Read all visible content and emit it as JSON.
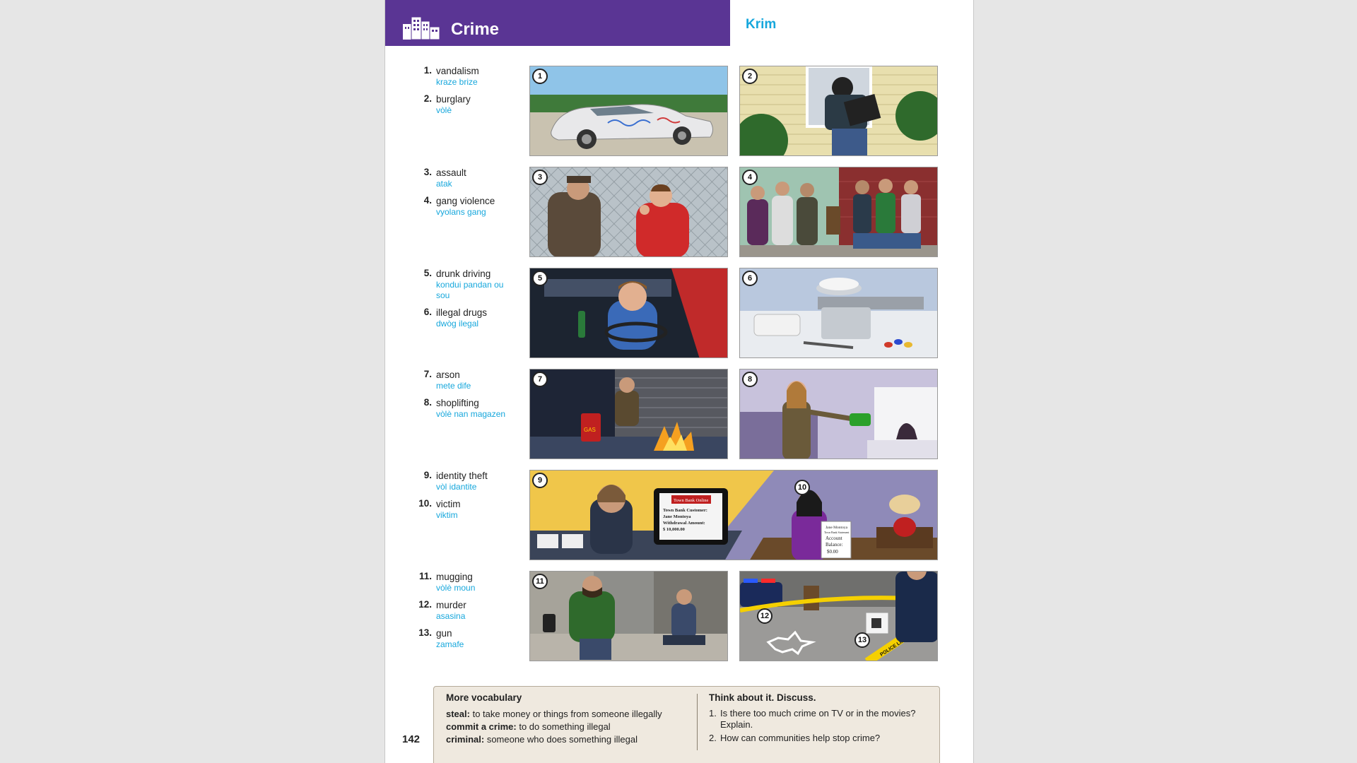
{
  "header": {
    "title": "Crime",
    "translation": "Krim"
  },
  "vocab": [
    {
      "num": "1.",
      "en": "vandalism",
      "ht": "kraze brize"
    },
    {
      "num": "2.",
      "en": "burglary",
      "ht": "vòlè"
    },
    {
      "num": "3.",
      "en": "assault",
      "ht": "atak"
    },
    {
      "num": "4.",
      "en": "gang violence",
      "ht": "vyolans gang"
    },
    {
      "num": "5.",
      "en": "drunk driving",
      "ht": "kondui pandan ou sou"
    },
    {
      "num": "6.",
      "en": "illegal drugs",
      "ht": "dwòg ilegal"
    },
    {
      "num": "7.",
      "en": "arson",
      "ht": "mete dife"
    },
    {
      "num": "8.",
      "en": "shoplifting",
      "ht": "vòlè nan magazen"
    },
    {
      "num": "9.",
      "en": "identity theft",
      "ht": "vòl idantite"
    },
    {
      "num": "10.",
      "en": "victim",
      "ht": "viktim"
    },
    {
      "num": "11.",
      "en": "mugging",
      "ht": "vòlè moun"
    },
    {
      "num": "12.",
      "en": "murder",
      "ht": "asasina"
    },
    {
      "num": "13.",
      "en": "gun",
      "ht": "zamafe"
    }
  ],
  "badges": [
    "1",
    "2",
    "3",
    "4",
    "5",
    "6",
    "7",
    "8",
    "9",
    "10",
    "11",
    "12",
    "13"
  ],
  "illustration_text": {
    "gas_can": "GAS",
    "bank_title": "Town Bank Online",
    "bank_line1": "Town Bank Customer:",
    "bank_line2": "Jane Montoya",
    "bank_line3": "Withdrawal Amount:",
    "bank_line4": "$ 10,000.00",
    "stmt_line1": "Jane Montoya",
    "stmt_line2": "Town Bank Statement",
    "stmt_line3": "Account",
    "stmt_line4": "Balance:",
    "stmt_line5": "$0.00",
    "police_tape": "POLICE LINE DO NOT CROSS"
  },
  "page_number": "142",
  "more_vocabulary": {
    "title": "More vocabulary",
    "items": [
      {
        "term": "steal:",
        "def": "to take money or things from someone illegally"
      },
      {
        "term": "commit a crime:",
        "def": "to do something illegal"
      },
      {
        "term": "criminal:",
        "def": "someone who does something illegal"
      }
    ]
  },
  "discuss": {
    "title": "Think about it. Discuss.",
    "questions": [
      {
        "num": "1.",
        "text": "Is there too much crime on TV or in the movies? Explain."
      },
      {
        "num": "2.",
        "text": "How can communities help stop crime?"
      }
    ]
  },
  "colors": {
    "header_band": "#5a3594",
    "translation": "#16a7dc",
    "box_bg": "#efe9df"
  }
}
